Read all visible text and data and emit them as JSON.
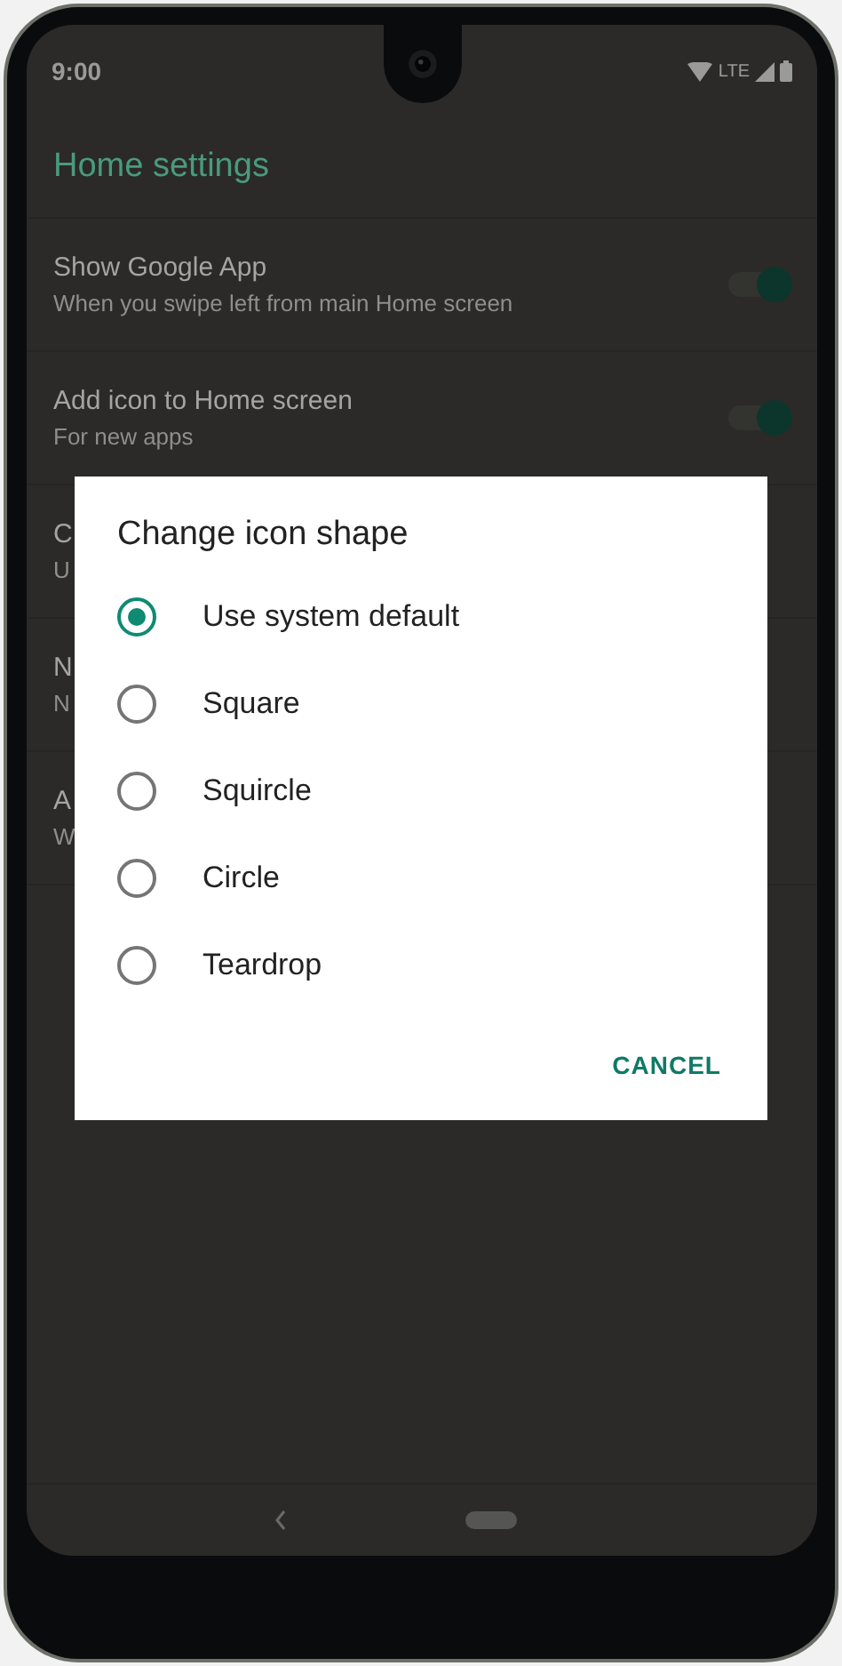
{
  "status_bar": {
    "time": "9:00",
    "network": "LTE"
  },
  "header": {
    "title": "Home settings"
  },
  "settings": [
    {
      "title": "Show Google App",
      "subtitle": "When you swipe left from main Home screen",
      "kind": "toggle",
      "on": true
    },
    {
      "title": "Add icon to Home screen",
      "subtitle": "For new apps",
      "kind": "toggle",
      "on": true
    },
    {
      "title": "C",
      "subtitle": "U",
      "kind": "plain"
    },
    {
      "title": "N",
      "subtitle": "N",
      "kind": "plain"
    },
    {
      "title": "A",
      "subtitle": "W",
      "kind": "plain"
    }
  ],
  "dialog": {
    "title": "Change icon shape",
    "options": [
      {
        "label": "Use system default",
        "selected": true
      },
      {
        "label": "Square",
        "selected": false
      },
      {
        "label": "Squircle",
        "selected": false
      },
      {
        "label": "Circle",
        "selected": false
      },
      {
        "label": "Teardrop",
        "selected": false
      }
    ],
    "button": "CANCEL"
  }
}
